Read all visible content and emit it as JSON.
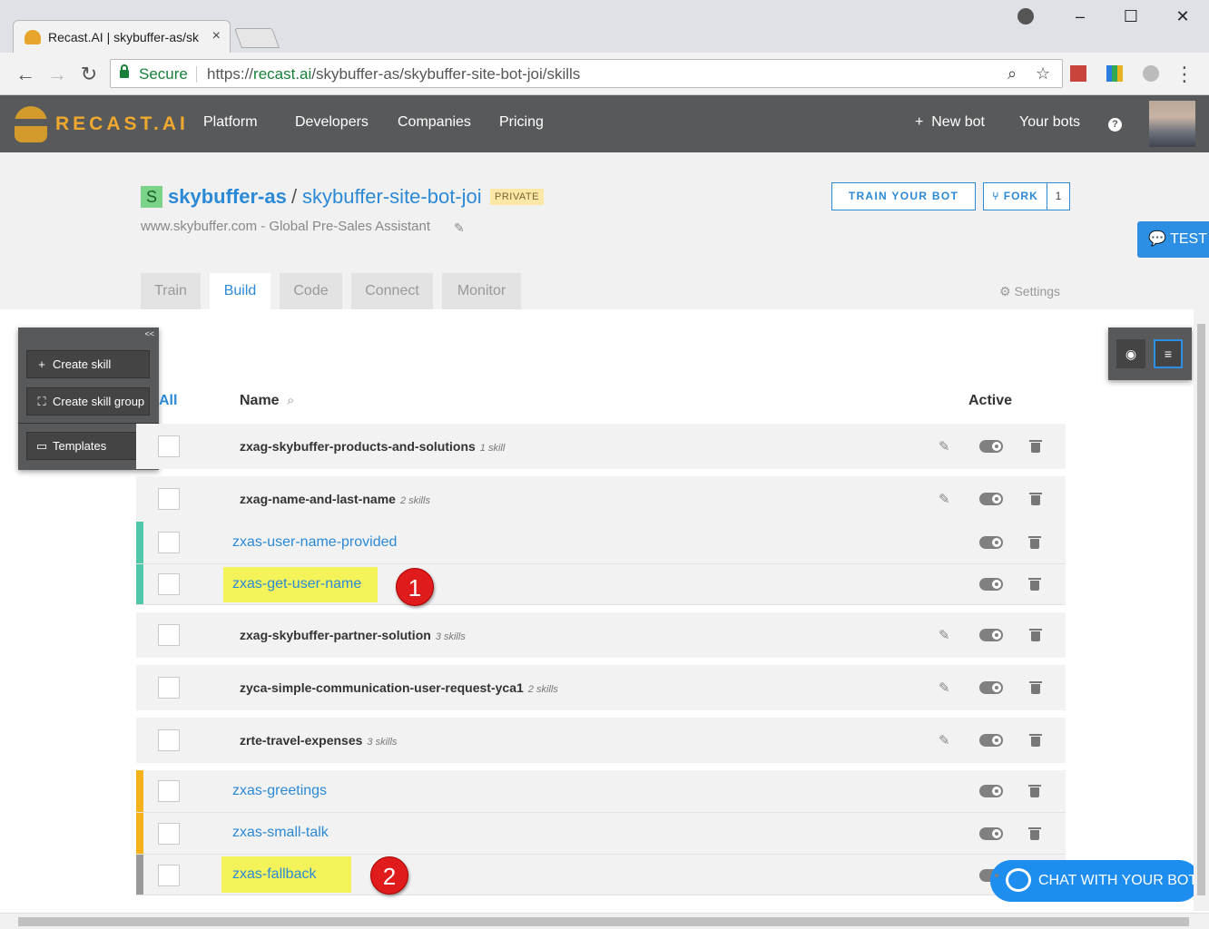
{
  "browser": {
    "tab_title": "Recast.AI | skybuffer-as/sk",
    "tab_close": "×",
    "secure_label": "Secure",
    "url_scheme": "https://",
    "url_host": "recast.ai",
    "url_path": "/skybuffer-as/skybuffer-site-bot-joi/skills",
    "window_buttons": [
      "–",
      "☐",
      "✕"
    ]
  },
  "site_header": {
    "logo_text": "RECAST.AI",
    "nav": [
      "Platform",
      "Developers",
      "Companies",
      "Pricing"
    ],
    "new_bot": "+  New bot",
    "your_bots": "Your bots",
    "help": "?"
  },
  "bot": {
    "badge": "S",
    "owner": "skybuffer-as",
    "separator": "/",
    "name": "skybuffer-site-bot-joi",
    "visibility": "PRIVATE",
    "description": "www.skybuffer.com - Global Pre-Sales Assistant",
    "train_button": "TRAIN YOUR BOT",
    "fork_button": "FORK",
    "fork_count": "1",
    "tabs": [
      "Train",
      "Build",
      "Code",
      "Connect",
      "Monitor"
    ],
    "active_tab": "Build",
    "settings": "Settings"
  },
  "test_button": "TEST",
  "side_panel": {
    "collapse": "<<",
    "create_skill": "Create skill",
    "create_group": "Create skill group",
    "templates": "Templates"
  },
  "table": {
    "headers": {
      "all": "All",
      "name": "Name",
      "active": "Active"
    },
    "rows": [
      {
        "kind": "group",
        "name": "zxag-skybuffer-products-and-solutions",
        "count": "1 skill"
      },
      {
        "kind": "group",
        "name": "zxag-name-and-last-name",
        "count": "2 skills"
      },
      {
        "kind": "skill",
        "name": "zxas-user-name-provided",
        "stripe": "#4fc7a8"
      },
      {
        "kind": "skill",
        "name": "zxas-get-user-name",
        "stripe": "#4fc7a8",
        "highlight": true,
        "marker": "1"
      },
      {
        "kind": "group",
        "name": "zxag-skybuffer-partner-solution",
        "count": "3 skills"
      },
      {
        "kind": "group",
        "name": "zyca-simple-communication-user-request-yca1",
        "count": "2 skills"
      },
      {
        "kind": "group",
        "name": "zrte-travel-expenses",
        "count": "3 skills"
      },
      {
        "kind": "skill",
        "name": "zxas-greetings",
        "stripe": "#f5b21b"
      },
      {
        "kind": "skill",
        "name": "zxas-small-talk",
        "stripe": "#f5b21b"
      },
      {
        "kind": "skill",
        "name": "zxas-fallback",
        "stripe": "#999999",
        "highlight": true,
        "marker": "2"
      }
    ]
  },
  "chat_button": "CHAT WITH YOUR BOT",
  "colors": {
    "accent": "#2c89d6",
    "header_bg": "#58595b",
    "logo": "#f0a92d",
    "highlight": "#f5f35a",
    "marker": "#e01b1b"
  }
}
